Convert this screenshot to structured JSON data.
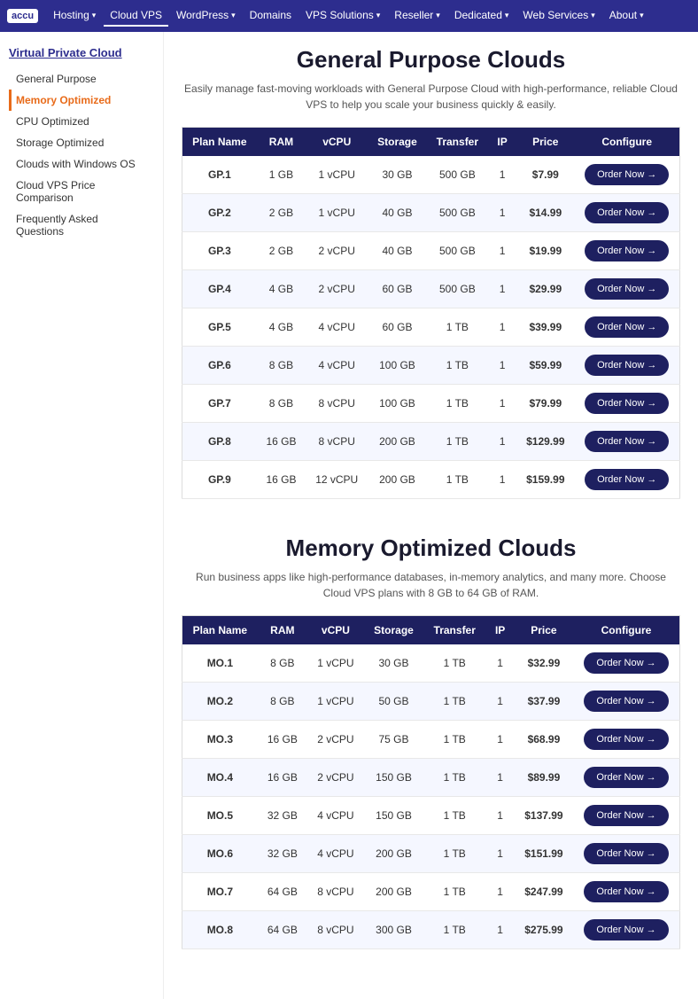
{
  "nav": {
    "logo": "accu",
    "items": [
      {
        "label": "Hosting",
        "hasDropdown": true,
        "active": false
      },
      {
        "label": "Cloud VPS",
        "hasDropdown": false,
        "active": true
      },
      {
        "label": "WordPress",
        "hasDropdown": true,
        "active": false
      },
      {
        "label": "Domains",
        "hasDropdown": false,
        "active": false
      },
      {
        "label": "VPS Solutions",
        "hasDropdown": true,
        "active": false
      },
      {
        "label": "Reseller",
        "hasDropdown": true,
        "active": false
      },
      {
        "label": "Dedicated",
        "hasDropdown": true,
        "active": false
      },
      {
        "label": "Web Services",
        "hasDropdown": true,
        "active": false
      },
      {
        "label": "About",
        "hasDropdown": true,
        "active": false
      }
    ]
  },
  "sidebar": {
    "title": "Virtual Private Cloud",
    "items": [
      {
        "label": "General Purpose",
        "active": false
      },
      {
        "label": "Memory Optimized",
        "active": true
      },
      {
        "label": "CPU Optimized",
        "active": false
      },
      {
        "label": "Storage Optimized",
        "active": false
      },
      {
        "label": "Clouds with Windows OS",
        "active": false
      },
      {
        "label": "Cloud VPS Price Comparison",
        "active": false
      },
      {
        "label": "Frequently Asked Questions",
        "active": false
      }
    ]
  },
  "generalPurpose": {
    "title": "General Purpose Clouds",
    "description": "Easily manage fast-moving workloads with General Purpose Cloud with high-performance, reliable Cloud VPS to help you scale your business quickly & easily.",
    "columns": [
      "Plan Name",
      "RAM",
      "vCPU",
      "Storage",
      "Transfer",
      "IP",
      "Price",
      "Configure"
    ],
    "rows": [
      {
        "plan": "GP.1",
        "ram": "1 GB",
        "vcpu": "1 vCPU",
        "storage": "30 GB",
        "transfer": "500 GB",
        "ip": "1",
        "price": "$7.99"
      },
      {
        "plan": "GP.2",
        "ram": "2 GB",
        "vcpu": "1 vCPU",
        "storage": "40 GB",
        "transfer": "500 GB",
        "ip": "1",
        "price": "$14.99"
      },
      {
        "plan": "GP.3",
        "ram": "2 GB",
        "vcpu": "2 vCPU",
        "storage": "40 GB",
        "transfer": "500 GB",
        "ip": "1",
        "price": "$19.99"
      },
      {
        "plan": "GP.4",
        "ram": "4 GB",
        "vcpu": "2 vCPU",
        "storage": "60 GB",
        "transfer": "500 GB",
        "ip": "1",
        "price": "$29.99"
      },
      {
        "plan": "GP.5",
        "ram": "4 GB",
        "vcpu": "4 vCPU",
        "storage": "60 GB",
        "transfer": "1 TB",
        "ip": "1",
        "price": "$39.99"
      },
      {
        "plan": "GP.6",
        "ram": "8 GB",
        "vcpu": "4 vCPU",
        "storage": "100 GB",
        "transfer": "1 TB",
        "ip": "1",
        "price": "$59.99"
      },
      {
        "plan": "GP.7",
        "ram": "8 GB",
        "vcpu": "8 vCPU",
        "storage": "100 GB",
        "transfer": "1 TB",
        "ip": "1",
        "price": "$79.99"
      },
      {
        "plan": "GP.8",
        "ram": "16 GB",
        "vcpu": "8 vCPU",
        "storage": "200 GB",
        "transfer": "1 TB",
        "ip": "1",
        "price": "$129.99"
      },
      {
        "plan": "GP.9",
        "ram": "16 GB",
        "vcpu": "12 vCPU",
        "storage": "200 GB",
        "transfer": "1 TB",
        "ip": "1",
        "price": "$159.99"
      }
    ],
    "orderLabel": "Order Now →"
  },
  "memoryOptimized": {
    "title": "Memory Optimized Clouds",
    "description": "Run business apps like high-performance databases, in-memory analytics, and many more. Choose Cloud VPS plans with 8 GB to 64 GB of RAM.",
    "columns": [
      "Plan Name",
      "RAM",
      "vCPU",
      "Storage",
      "Transfer",
      "IP",
      "Price",
      "Configure"
    ],
    "rows": [
      {
        "plan": "MO.1",
        "ram": "8 GB",
        "vcpu": "1 vCPU",
        "storage": "30 GB",
        "transfer": "1 TB",
        "ip": "1",
        "price": "$32.99"
      },
      {
        "plan": "MO.2",
        "ram": "8 GB",
        "vcpu": "1 vCPU",
        "storage": "50 GB",
        "transfer": "1 TB",
        "ip": "1",
        "price": "$37.99"
      },
      {
        "plan": "MO.3",
        "ram": "16 GB",
        "vcpu": "2 vCPU",
        "storage": "75 GB",
        "transfer": "1 TB",
        "ip": "1",
        "price": "$68.99"
      },
      {
        "plan": "MO.4",
        "ram": "16 GB",
        "vcpu": "2 vCPU",
        "storage": "150 GB",
        "transfer": "1 TB",
        "ip": "1",
        "price": "$89.99"
      },
      {
        "plan": "MO.5",
        "ram": "32 GB",
        "vcpu": "4 vCPU",
        "storage": "150 GB",
        "transfer": "1 TB",
        "ip": "1",
        "price": "$137.99"
      },
      {
        "plan": "MO.6",
        "ram": "32 GB",
        "vcpu": "4 vCPU",
        "storage": "200 GB",
        "transfer": "1 TB",
        "ip": "1",
        "price": "$151.99"
      },
      {
        "plan": "MO.7",
        "ram": "64 GB",
        "vcpu": "8 vCPU",
        "storage": "200 GB",
        "transfer": "1 TB",
        "ip": "1",
        "price": "$247.99"
      },
      {
        "plan": "MO.8",
        "ram": "64 GB",
        "vcpu": "8 vCPU",
        "storage": "300 GB",
        "transfer": "1 TB",
        "ip": "1",
        "price": "$275.99"
      }
    ],
    "orderLabel": "Order Now →"
  }
}
